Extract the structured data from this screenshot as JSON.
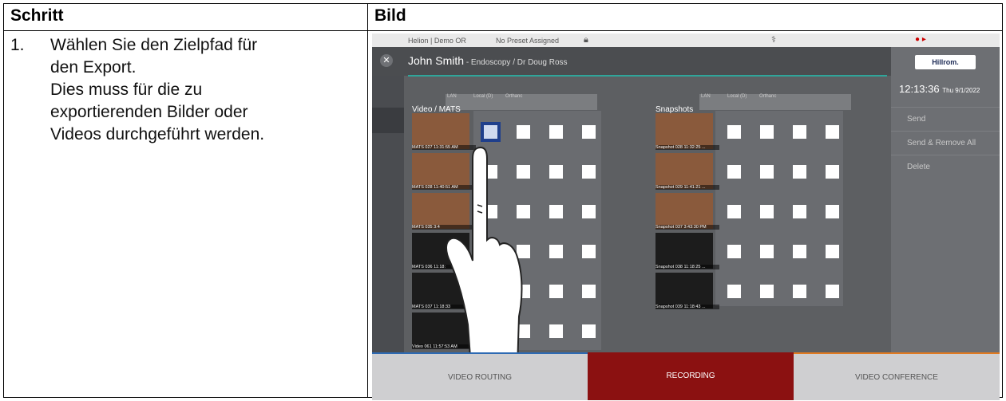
{
  "header": {
    "col1": "Schritt",
    "col2": "Bild"
  },
  "step": {
    "number": "1.",
    "lines": [
      "Wählen Sie den Zielpfad für",
      "den Export.",
      "Dies muss für die zu",
      "exportierenden Bilder oder",
      "Videos durchgeführt werden."
    ]
  },
  "screen": {
    "status": {
      "room": "Helion | Demo OR",
      "preset": "No Preset Assigned"
    },
    "patient": {
      "name": "John Smith",
      "detail": " - Endoscopy / Dr Doug Ross"
    },
    "brand": "Hillrom.",
    "time": "12:13:36",
    "date": "Thu 9/1/2022",
    "actions": [
      "Send",
      "Send & Remove All",
      "Delete"
    ],
    "columns": [
      "LAN",
      "Local (D)",
      "Orthanc"
    ],
    "video_section": "Video / MATS",
    "snapshot_section": "Snapshots",
    "videos": [
      "MATS 027 11:31:55 AM",
      "MATS 028 11:40:51 AM",
      "MATS 035 3:4",
      "MATS 036 11:18:",
      "MATS 037 11:18:33",
      "Video 061 11:57:53 AM"
    ],
    "snapshots": [
      "Snapshot 028 11:32:25 ...",
      "Snapshot 029 11:41:21 ...",
      "Snapshot 037 3:43:30 PM",
      "Snapshot 038 11:18:25 ...",
      "Snapshot 039 11:18:43 ..."
    ],
    "nav": [
      "VIDEO ROUTING",
      "RECORDING",
      "VIDEO CONFERENCE"
    ]
  }
}
